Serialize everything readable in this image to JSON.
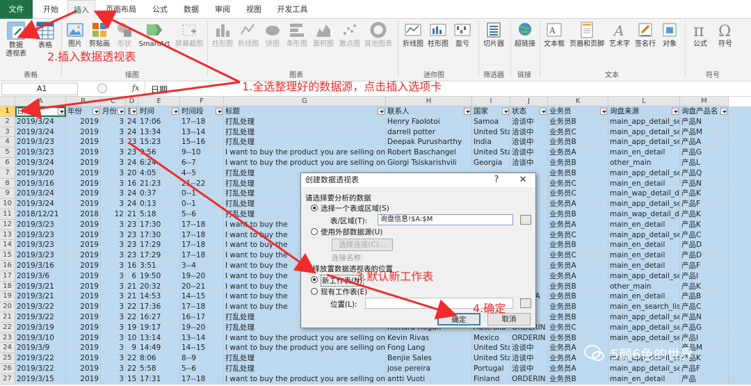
{
  "tabs": [
    "文件",
    "开始",
    "插入",
    "页面布局",
    "公式",
    "数据",
    "审阅",
    "视图",
    "开发工具"
  ],
  "ribbon": {
    "pivot": "数据",
    "pivot2": "透视表",
    "table": "表格",
    "group_table": "表格",
    "picture": "图片",
    "online_pic": "剪贴画",
    "shapes": "形状",
    "smartart": "SmartArt",
    "screenshot": "屏幕截图",
    "group_illus": "插图",
    "charts": [
      "柱形图",
      "折线图",
      "饼图",
      "条形图",
      "面积图",
      "散点图",
      "其他图表"
    ],
    "group_charts": "图表",
    "sparklines": [
      "折线图",
      "柱形图",
      "盈亏"
    ],
    "group_spark": "迷你图",
    "slicer": "切片器",
    "group_filter": "筛选器",
    "hyperlink": "超链接",
    "group_link": "链接",
    "text": [
      "文本框",
      "页眉和页脚",
      "艺术字",
      "签名行",
      "对象"
    ],
    "group_text": "文本",
    "symbols": [
      "公式",
      "符号"
    ],
    "group_sym": "符号"
  },
  "formula_bar": {
    "cell_ref": "A1",
    "fx": "fx",
    "value": "日期"
  },
  "columns": [
    "A",
    "B",
    "C",
    "D",
    "E",
    "F",
    "G",
    "H",
    "I",
    "J",
    "K",
    "L",
    "M"
  ],
  "headers": [
    "日期",
    "年份",
    "月份",
    "日",
    "时间",
    "时间段",
    "标题",
    "联系人",
    "国家",
    "状态",
    "业务员",
    "询盘来源",
    "询盘产品名"
  ],
  "rows": [
    [
      "2019/3/24",
      "2019",
      "3",
      "24",
      "17:06",
      "17--18",
      "打乱处理",
      "Henry Faolotoi",
      "Samoa",
      "洽谈中",
      "业务员B",
      "main_app_detail_se",
      "产品N"
    ],
    [
      "2019/3/24",
      "2019",
      "3",
      "24",
      "13:34",
      "13--14",
      "打乱处理",
      "darrell potter",
      "United Sta",
      "洽谈中",
      "业务员C",
      "main_app_detail_se",
      "产品M"
    ],
    [
      "2019/3/23",
      "2019",
      "3",
      "23",
      "15:23",
      "15--16",
      "打乱处理",
      "Deepak Purusharthy",
      "India",
      "洽谈中",
      "业务员B",
      "main_app_detail_se",
      "产品A"
    ],
    [
      "2019/3/23",
      "2019",
      "3",
      "23",
      "9:56",
      "9--10",
      "I want to buy the product you are selling on Al",
      "Robert Baschangel",
      "United Sta",
      "洽谈中",
      "业务员A",
      "main_en_detail",
      "产品G"
    ],
    [
      "2019/3/24",
      "2019",
      "3",
      "24",
      "6:24",
      "6--7",
      "I want to buy the product you are selling on Al",
      "Giorgi Tsiskarishvili",
      "Georgia",
      "洽谈中",
      "业务员B",
      "other_main",
      "产品L"
    ],
    [
      "2019/3/20",
      "2019",
      "3",
      "20",
      "4:05",
      "4--5",
      "打乱处理",
      "",
      "",
      "",
      "业务员B",
      "main_app_detail_se",
      "产品Q"
    ],
    [
      "2019/3/16",
      "2019",
      "3",
      "16",
      "21:23",
      "21--22",
      "打乱处理",
      "",
      "",
      "",
      "业务员C",
      "main_en_detail",
      "产品N"
    ],
    [
      "2019/3/24",
      "2019",
      "3",
      "24",
      "0:37",
      "0--1",
      "打乱处理",
      "",
      "",
      "",
      "业务员C",
      "main_wap_detail_de",
      "产品K"
    ],
    [
      "2019/3/24",
      "2019",
      "3",
      "24",
      "0:13",
      "0--1",
      "打乱处理",
      "",
      "",
      "",
      "业务员A",
      "main_app_detail_se",
      "产品F"
    ],
    [
      "2018/12/21",
      "2018",
      "12",
      "21",
      "5:18",
      "5--6",
      "打乱处理",
      "",
      "",
      "",
      "业务员B",
      "main_wap_detail_de",
      "产品K"
    ],
    [
      "2019/3/23",
      "2019",
      "3",
      "23",
      "17:30",
      "17--18",
      "I want to buy the",
      "",
      "",
      "",
      "业务员A",
      "main_en_detail",
      "产品K"
    ],
    [
      "2019/3/23",
      "2019",
      "3",
      "23",
      "17:30",
      "17--18",
      "I want to buy the",
      "",
      "",
      "",
      "业务员C",
      "main_app_detail_se",
      "产品C"
    ],
    [
      "2019/3/23",
      "2019",
      "3",
      "23",
      "17:29",
      "17--18",
      "I want to buy the",
      "",
      "",
      "",
      "业务员B",
      "main_en_detail",
      "产品D"
    ],
    [
      "2019/3/23",
      "2019",
      "3",
      "23",
      "17:29",
      "17--18",
      "I want to buy the",
      "",
      "",
      "",
      "业务员C",
      "main_en_detail",
      "产品D"
    ],
    [
      "2019/3/16",
      "2019",
      "3",
      "16",
      "3:51",
      "3--4",
      "I want to buy the",
      "",
      "",
      "",
      "业务员A",
      "main_en_detail",
      "产品F"
    ],
    [
      "2019/3/6",
      "2019",
      "3",
      "6",
      "19:50",
      "19--20",
      "I want to buy the",
      "",
      "",
      "",
      "业务员A",
      "main_app_detail_se",
      "产品I"
    ],
    [
      "2019/3/21",
      "2019",
      "3",
      "21",
      "20:32",
      "20--21",
      "I want to buy the",
      "",
      "",
      "",
      "业务员B",
      "other_main",
      "产品K"
    ],
    [
      "2019/3/21",
      "2019",
      "3",
      "21",
      "14:53",
      "14--15",
      "I want to buy the",
      "",
      "",
      "TIAL_PA",
      "业务员B",
      "main_en_detail",
      "产品B"
    ],
    [
      "2019/3/22",
      "2019",
      "3",
      "22",
      "17:36",
      "17--18",
      "I want to buy the",
      "",
      "",
      "",
      "业务员B",
      "main_en_search_lis",
      "产品C"
    ],
    [
      "2019/3/22",
      "2019",
      "3",
      "22",
      "16:27",
      "16--17",
      "打乱处理",
      "",
      "",
      "",
      "业务员B",
      "main_app_detail_se",
      "产品N"
    ],
    [
      "2019/3/19",
      "2019",
      "3",
      "19",
      "19:17",
      "19--20",
      "打乱处理",
      "Richard Hogan",
      "Australia",
      "ORDERIN",
      "业务员C",
      "main_app_detail_se",
      "产品G"
    ],
    [
      "2019/3/10",
      "2019",
      "3",
      "10",
      "13:14",
      "13--14",
      "I want to buy the product you are selling on Al",
      "Kevin Rivas",
      "Mexico",
      "ORDERIN",
      "业务员B",
      "main_app_detail_se",
      "产品I"
    ],
    [
      "2019/3/9",
      "2019",
      "3",
      "9",
      "14:49",
      "14--15",
      "I want to buy the product you are selling on Al",
      "Fong Lang",
      "United Sta",
      "洽谈中",
      "业务员A",
      "",
      "产品M"
    ],
    [
      "2019/3/22",
      "2019",
      "3",
      "22",
      "8:06",
      "8--9",
      "打乱处理",
      "Benjie Sales",
      "United Sta",
      "洽谈中",
      "业务员A",
      "main_app_detail_se",
      "产品K"
    ],
    [
      "2019/3/22",
      "2019",
      "3",
      "22",
      "5:58",
      "5--6",
      "打乱处理",
      "jose pereira",
      "Portugal",
      "洽谈中",
      "业务员A",
      "main_app_detail_se",
      "产品F"
    ],
    [
      "2019/3/15",
      "2019",
      "3",
      "15",
      "17:31",
      "17--18",
      "I want to buy the product you are selling on Al",
      "antti Vuoti",
      "Finland",
      "ORDERIN",
      "业务员B",
      "main_en_detail",
      "产品"
    ]
  ],
  "dialog": {
    "title": "创建数据透视表",
    "help": "?",
    "close": "✕",
    "section1": "请选择要分析的数据",
    "opt_range": "选择一个表或区域(S)",
    "range_label": "表/区域(T):",
    "range_value": "询盘信息!$A:$M",
    "opt_external": "使用外部数据源(U)",
    "choose_conn": "选择连接(C)...",
    "conn_name": "连接名称:",
    "section2": "选择放置数据透视表的位置",
    "opt_new": "新工作表(N)",
    "opt_existing": "现有工作表(E)",
    "location": "位置(L):",
    "ok": "确定",
    "cancel": "取消"
  },
  "annotations": {
    "a1": "1.全选整理好的数据源，点击插入选项卡",
    "a2": "2.插入数据透视表",
    "a3": "3.默认新工作表",
    "a4": "4.确定"
  },
  "watermark": "5颜6色的世界",
  "colors": {
    "accent": "#217346",
    "selection": "#bcd9f0",
    "annotation": "#f02b2b"
  }
}
